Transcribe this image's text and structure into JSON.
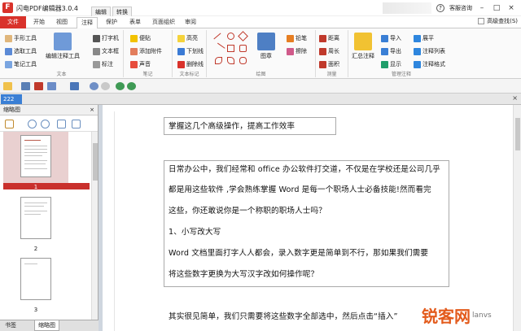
{
  "app": {
    "title": "闪电PDF编辑器3.0.4",
    "logo_glyph": "F"
  },
  "ctx_tabs": [
    "编辑",
    "转换"
  ],
  "title_right": {
    "help": "客服咨询"
  },
  "ribbon_tabs": {
    "file": "文件",
    "tabs": [
      "开始",
      "视图",
      "注释",
      "保护",
      "表单",
      "页面组织",
      "审阅"
    ],
    "active": "注释",
    "adv_search": "高级查找(S)"
  },
  "groups": {
    "text": {
      "label": "文本",
      "items": [
        "手形工具",
        "选取工具",
        "笔记工具"
      ],
      "big": "编辑注释工具",
      "more": [
        "打字机",
        "文本框",
        "标注"
      ]
    },
    "note": {
      "label": "笔记",
      "items": [
        "便贴",
        "添加附件",
        "声音"
      ]
    },
    "mark": {
      "label": "文本标记",
      "items": [
        "高亮",
        "下划线",
        "删除线"
      ]
    },
    "draw": {
      "label": "绘图",
      "big": "图章",
      "items": [
        "铅笔",
        "擦除"
      ]
    },
    "measure": {
      "label": "测量",
      "items": [
        "距离",
        "周长",
        "面积"
      ]
    },
    "manage": {
      "label": "管理注释",
      "big": "汇总注释",
      "items": [
        "导入",
        "导出",
        "显示",
        "展平",
        "注释列表",
        "注释格式"
      ]
    }
  },
  "doc_tab": {
    "name": "222",
    "close": "×"
  },
  "sidebar": {
    "title": "缩略图",
    "close": "×",
    "pages": [
      "1",
      "2",
      "3"
    ],
    "bottom_tabs": [
      "书签",
      "缩略图"
    ]
  },
  "document": {
    "line1": "掌握这几个高级操作，提高工作效率",
    "lines": [
      "日常办公中，我们经常和 office 办公软件打交道，不仅是在学校还是公司几乎",
      "都是用这些软件 ,学会熟练掌握 Word 是每一个职场人士必备技能!然而看完",
      "这些，你还敢说你是一个称职的职场人士吗？",
      "1、小写改大写",
      "Word 文档里面打字人人都会，录入数字更是简单到不行，那如果我们需要",
      "将这些数字更换为大写汉字改如何操作呢？"
    ],
    "line_after": "其实很见简单，我们只需要将这些数字全部选中，然后点击“插入”"
  },
  "watermark": {
    "brand": "锐客网",
    "sub": "lanvs"
  }
}
